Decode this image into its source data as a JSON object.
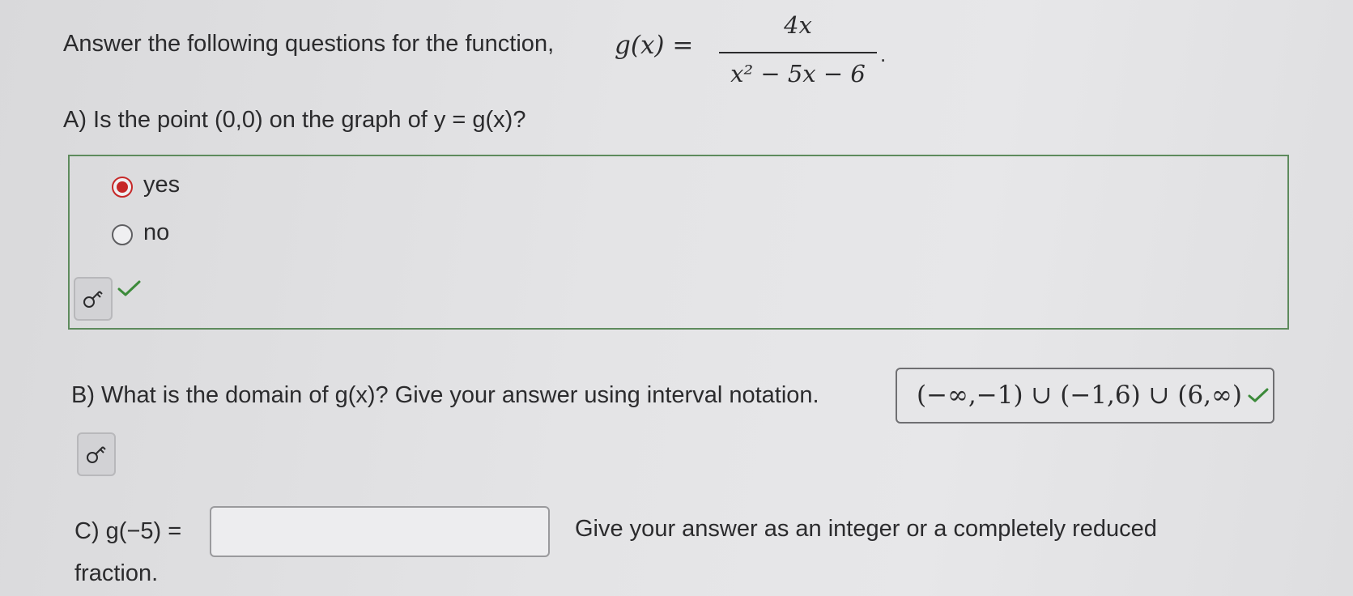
{
  "header": {
    "intro": "Answer the following questions for the function,",
    "func_label": "g(x) =",
    "numerator": "4x",
    "denominator": "x² − 5x − 6",
    "period": "."
  },
  "part_a": {
    "question": "A) Is the point (0,0) on the graph of y = g(x)?",
    "options": [
      {
        "label": "yes",
        "selected": true
      },
      {
        "label": "no",
        "selected": false
      }
    ],
    "status": "correct"
  },
  "part_b": {
    "question": "B) What is the domain of g(x)? Give your answer using interval notation.",
    "answer": "(−∞,−1) ∪ (−1,6) ∪ (6,∞)",
    "status": "correct"
  },
  "part_c": {
    "label": "C) g(−5) =",
    "input_value": "",
    "instruction": "Give your answer as an integer or a completely reduced",
    "instruction_cont": "fraction."
  },
  "icons": {
    "key": "key-icon",
    "check": "check-icon"
  },
  "colors": {
    "correct_green": "#3c8a3a",
    "selected_red": "#c62828",
    "box_border": "#5e8b5d"
  }
}
